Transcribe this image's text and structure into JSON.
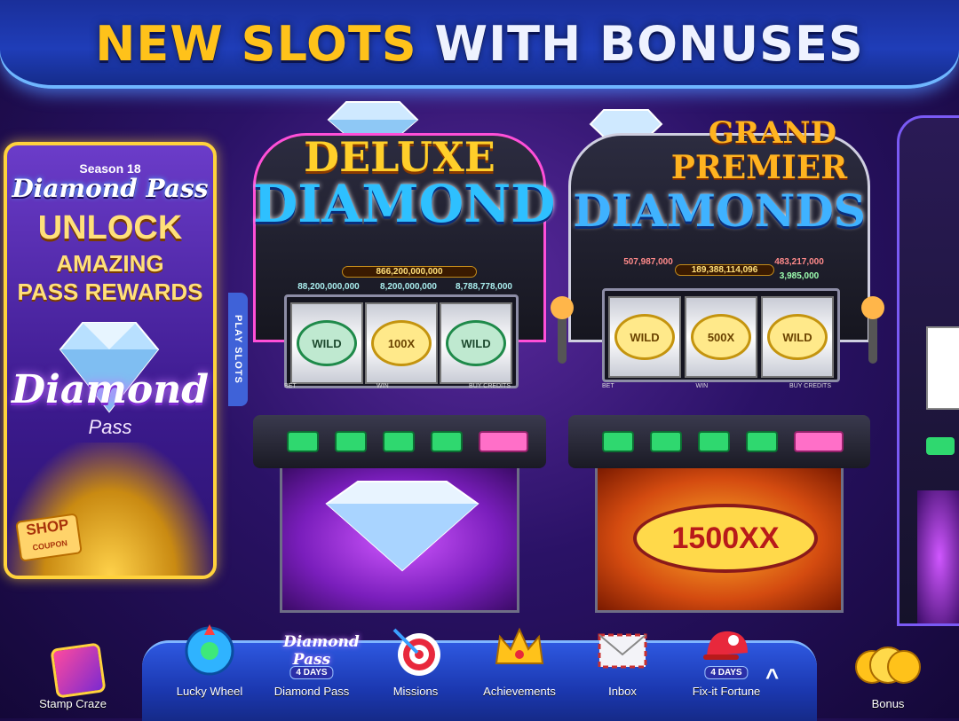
{
  "banner": {
    "title_highlight": "NEW SLOTS",
    "title_rest": "WITH BONUSES"
  },
  "pass_card": {
    "season": "Season 18",
    "logo": "Diamond Pass",
    "line1": "UNLOCK",
    "line2": "AMAZING",
    "line3": "PASS REWARDS",
    "big_logo": "Diamond",
    "big_logo_sub": "Pass",
    "shop_label": "SHOP",
    "shop_sub": "COUPON"
  },
  "play_tab": {
    "label": "PLAY SLOTS"
  },
  "machines": [
    {
      "title_line1": "DELUXE",
      "title_line2": "DIAMOND",
      "jackpot": "866,200,000,000",
      "mini1": "88,200,000,000",
      "mini2": "8,200,000,000",
      "mini3": "8,788,778,000",
      "reels": [
        "WILD",
        "100X",
        "WILD"
      ],
      "labels": [
        "BET",
        "WIN",
        "BUY CREDITS"
      ]
    },
    {
      "title_line1": "GRAND",
      "title_line2": "PREMIER",
      "title_line3": "DIAMONDS",
      "jackpot": "189,388,114,096",
      "mini1": "507,987,000",
      "mini2": "483,217,000",
      "mini3": "3,985,000",
      "reels": [
        "WILD",
        "500X",
        "WILD"
      ],
      "bottom_symbol": "1500XX",
      "labels": [
        "BET",
        "WIN",
        "BUY CREDITS"
      ]
    }
  ],
  "nav": {
    "stamp_craze": "Stamp Craze",
    "lucky_wheel": "Lucky Wheel",
    "diamond_pass": "Diamond Pass",
    "diamond_pass_days": "4 DAYS",
    "missions": "Missions",
    "achievements": "Achievements",
    "inbox": "Inbox",
    "fixit": "Fix-it Fortune",
    "fixit_days": "4 DAYS",
    "bonus": "Bonus",
    "expand_glyph": "^"
  },
  "colors": {
    "accent_gold": "#ffc21a",
    "banner_blue": "#1f3db8",
    "button_green": "#2fd86f"
  }
}
